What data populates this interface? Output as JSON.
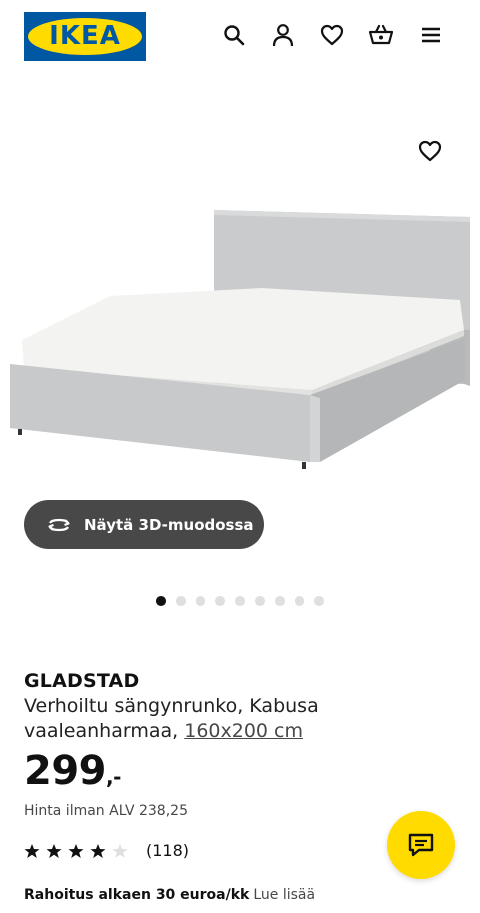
{
  "header": {
    "logo_text": "IKEA",
    "icons": [
      "search-icon",
      "user-icon",
      "heart-icon",
      "basket-icon",
      "menu-icon"
    ]
  },
  "gallery": {
    "button_3d_label": "Näytä 3D-muodossa",
    "dots_total": 9,
    "dots_active_index": 0
  },
  "product": {
    "name": "GLADSTAD",
    "description_prefix": "Verhoiltu sängynrunko, Kabusa vaaleanharmaa, ",
    "size_link": "160x200 cm",
    "price_main": "299",
    "price_suffix": ",-",
    "vat_text": "Hinta ilman ALV 238,25",
    "rating_stars": 4,
    "rating_max": 5,
    "rating_count": "(118)",
    "financing_strong": "Rahoitus alkaen 30 euroa/kk",
    "financing_link": "Lue lisää"
  },
  "colors": {
    "brand_blue": "#0058a3",
    "brand_yellow": "#ffdb00",
    "button_dark": "#484848"
  }
}
